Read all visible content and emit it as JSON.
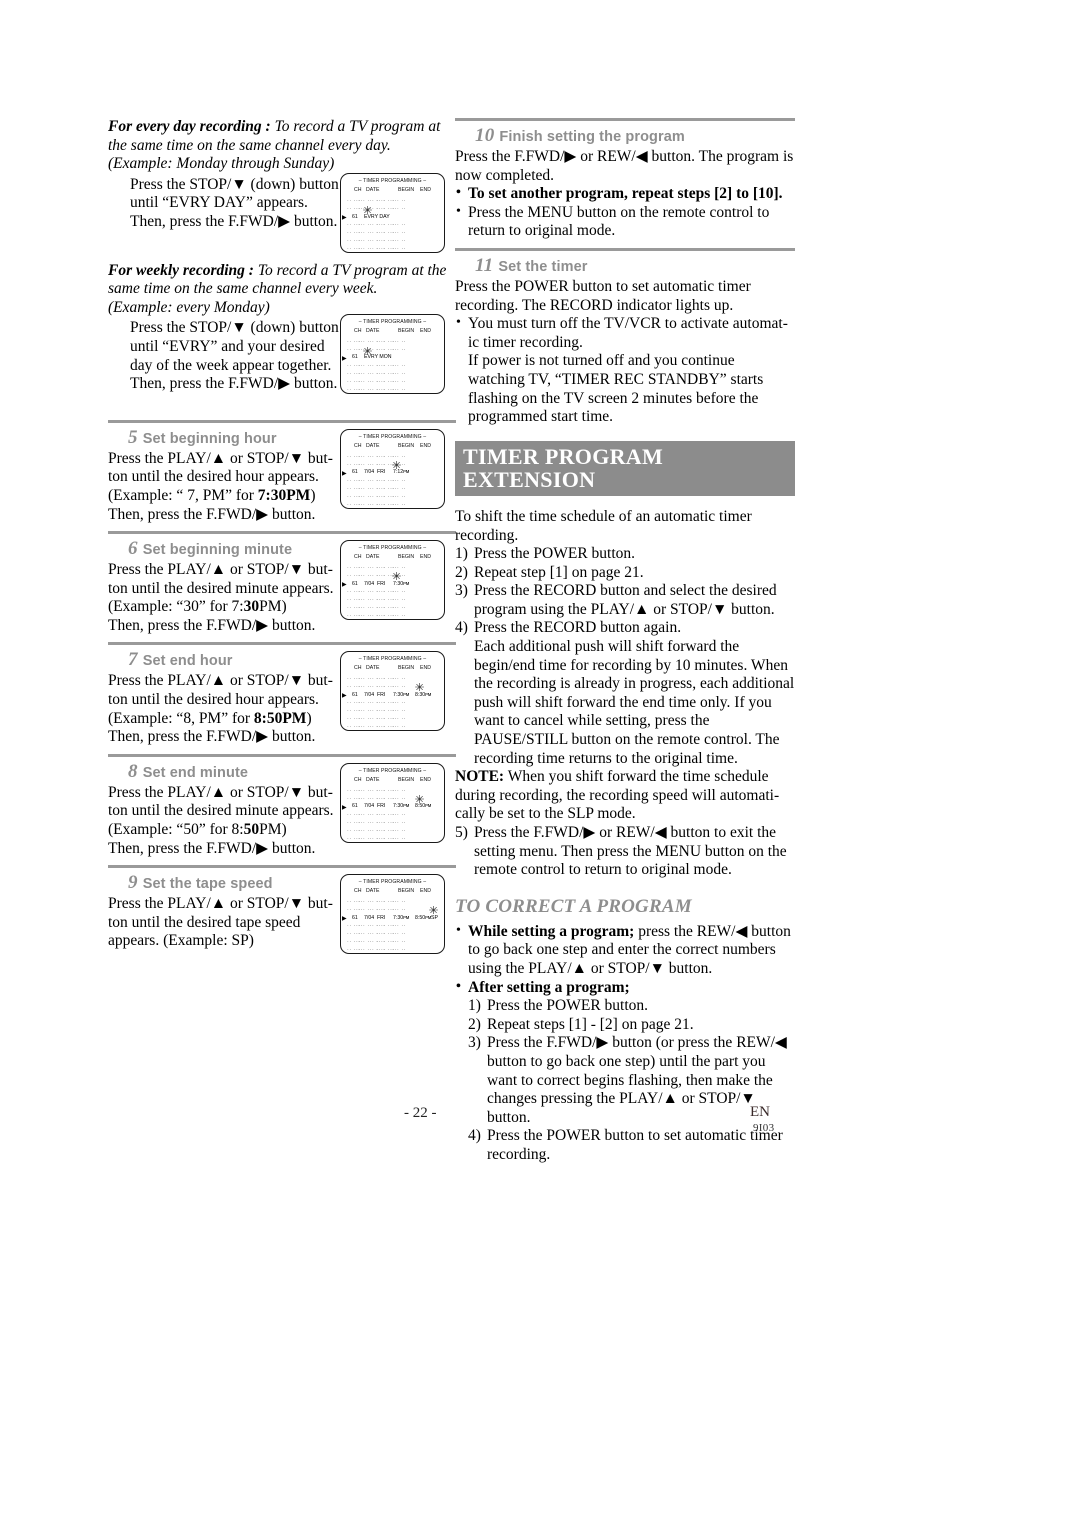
{
  "page": {
    "number": "- 22 -",
    "lang_code": "EN",
    "doc_code": "9I03"
  },
  "left_column": {
    "every_day": {
      "lead": "For every day recording :",
      "desc": " To record a TV program at the same time on the same channel every day.",
      "example": "(Example: Monday through Sunday)",
      "body": "Press the STOP/▼ (down) button until “EVRY DAY” appears. Then, press the F.FWD/▶ button.",
      "screen": {
        "title": "– TIMER PROGRAMMING –",
        "columns": [
          "CH",
          "DATE",
          "BEGIN",
          "END"
        ],
        "active_row": {
          "ch": "61",
          "text": "EVRY DAY"
        }
      }
    },
    "weekly": {
      "lead": "For weekly recording :",
      "desc": " To record a TV program at the same time on the same channel every week.",
      "example": "(Example: every Monday)",
      "body": "Press the STOP/▼ (down) button until “EVRY” and your desired day of the week appear together. Then, press the F.FWD/▶ button.",
      "screen": {
        "title": "– TIMER PROGRAMMING –",
        "columns": [
          "CH",
          "DATE",
          "BEGIN",
          "END"
        ],
        "active_row": {
          "ch": "61",
          "text": "EVRY MON"
        }
      }
    },
    "steps": [
      {
        "num": "5",
        "title": "Set beginning hour",
        "line1": "Press the PLAY/▲ or STOP/▼ but-",
        "line2": "ton until the desired hour appears.",
        "line3_pre": "(Example: “ 7, PM” for ",
        "line3_bold": "7:30PM",
        "line3_post": ")",
        "line4": "Then, press the F.FWD/▶ button.",
        "screen": {
          "title": "– TIMER PROGRAMMING –",
          "columns": [
            "CH",
            "DATE",
            "BEGIN",
            "END"
          ],
          "active_row": {
            "ch": "61",
            "date": "7/04",
            "day": "FRI",
            "begin": "7:12ᴘᴍ",
            "end": "",
            "sp": ""
          },
          "flash_target": "begin"
        }
      },
      {
        "num": "6",
        "title": "Set beginning minute",
        "line1": "Press the PLAY/▲ or STOP/▼ but-",
        "line2": "ton until the desired minute appears.",
        "line3_pre": "(Example: “30” for 7:",
        "line3_bold": "30",
        "line3_post": "PM)",
        "line4": "Then, press the F.FWD/▶ button.",
        "screen": {
          "title": "– TIMER PROGRAMMING –",
          "columns": [
            "CH",
            "DATE",
            "BEGIN",
            "END"
          ],
          "active_row": {
            "ch": "61",
            "date": "7/04",
            "day": "FRI",
            "begin": "7:30ᴘᴍ",
            "end": "",
            "sp": ""
          },
          "flash_target": "begin"
        }
      },
      {
        "num": "7",
        "title": "Set end hour",
        "line1": "Press the PLAY/▲ or STOP/▼ but-",
        "line2": "ton until the desired hour appears.",
        "line3_pre": "(Example: “8, PM” for ",
        "line3_bold": "8:50PM",
        "line3_post": ")",
        "line4": "Then, press the F.FWD/▶ button.",
        "screen": {
          "title": "– TIMER PROGRAMMING –",
          "columns": [
            "CH",
            "DATE",
            "BEGIN",
            "END"
          ],
          "active_row": {
            "ch": "61",
            "date": "7/04",
            "day": "FRI",
            "begin": "7:30ᴘᴍ",
            "end": "8:30ᴘᴍ",
            "sp": ""
          },
          "flash_target": "end"
        }
      },
      {
        "num": "8",
        "title": "Set end minute",
        "line1": "Press the PLAY/▲ or STOP/▼ but-",
        "line2": "ton until the desired minute appears.",
        "line3_pre": "(Example: “50” for 8:",
        "line3_bold": "50",
        "line3_post": "PM)",
        "line4": "Then, press the F.FWD/▶ button.",
        "screen": {
          "title": "– TIMER PROGRAMMING –",
          "columns": [
            "CH",
            "DATE",
            "BEGIN",
            "END"
          ],
          "active_row": {
            "ch": "61",
            "date": "7/04",
            "day": "FRI",
            "begin": "7:30ᴘᴍ",
            "end": "8:50ᴘᴍ",
            "sp": ""
          },
          "flash_target": "end"
        }
      },
      {
        "num": "9",
        "title": "Set the tape speed",
        "line1": "Press the PLAY/▲ or STOP/▼ but-",
        "line2": "ton until the desired tape speed",
        "line3_pre": "appears. (Example: SP)",
        "line3_bold": "",
        "line3_post": "",
        "line4": "",
        "screen": {
          "title": "– TIMER PROGRAMMING –",
          "columns": [
            "CH",
            "DATE",
            "BEGIN",
            "END"
          ],
          "active_row": {
            "ch": "61",
            "date": "7/04",
            "day": "FRI",
            "begin": "7:30ᴘᴍ",
            "end": "8:50ᴘᴍ",
            "sp": "SP"
          },
          "flash_target": "sp"
        }
      }
    ]
  },
  "right_column": {
    "step10": {
      "num": "10",
      "title": "Finish setting the program",
      "body": "Press the F.FWD/▶ or REW/◀ button. The program is now completed.",
      "bullet_bold": "To set another program, repeat steps [2] to [10].",
      "bullet2": "Press the MENU button on the remote control to return to original mode."
    },
    "step11": {
      "num": "11",
      "title": "Set the timer",
      "body": "Press the POWER button to set automatic timer recording. The RECORD indicator lights up.",
      "bullet1": "You must turn off the TV/VCR to activate automat-ic timer recording.",
      "para2": "If power is not turned off and you continue watching TV, “TIMER REC STANDBY” starts flashing on the TV screen 2 minutes before the programmed start time."
    },
    "extension": {
      "banner": "TIMER PROGRAM EXTENSION",
      "intro": "To shift the time schedule of an automatic timer recording.",
      "steps": [
        {
          "n": "1)",
          "text": "Press the POWER button."
        },
        {
          "n": "2)",
          "text": "Repeat step [1] on page 21."
        },
        {
          "n": "3)",
          "text": "Press the RECORD button and select the desired program using the PLAY/▲ or STOP/▼ button."
        },
        {
          "n": "4)",
          "text": "Press the RECORD button again."
        }
      ],
      "step4_detail": "Each additional push will shift forward the begin/end time for recording by 10 minutes. When the recording is already in progress, each additional push will shift forward the end time only. If you want to cancel while setting, press the PAUSE/STILL button on the remote control. The recording time returns to the original time.",
      "note_label": "NOTE:",
      "note_text": " When you shift forward the time schedule during recording, the recording speed will automati-cally be set to the SLP mode.",
      "step5": {
        "n": "5)",
        "text": "Press the F.FWD/▶ or REW/◀ button to exit the setting menu. Then press the MENU button on the remote control to return to original mode."
      }
    },
    "correct": {
      "heading": "TO CORRECT A PROGRAM",
      "bullet1_bold": "While setting a program;",
      "bullet1_rest": " press the REW/◀ button to go back one step and enter the correct numbers using the PLAY/▲ or STOP/▼ button.",
      "bullet2_bold": "After setting a program;",
      "steps": [
        {
          "n": "1)",
          "text": "Press the POWER button."
        },
        {
          "n": "2)",
          "text": "Repeat steps [1] - [2] on page 21."
        },
        {
          "n": "3)",
          "text": "Press the F.FWD/▶ button (or press the REW/◀ button to go back one step) until the part you want to correct begins flashing, then make the changes pressing the PLAY/▲ or STOP/▼ button."
        },
        {
          "n": "4)",
          "text": "Press the POWER button to set automatic timer recording."
        }
      ]
    }
  }
}
